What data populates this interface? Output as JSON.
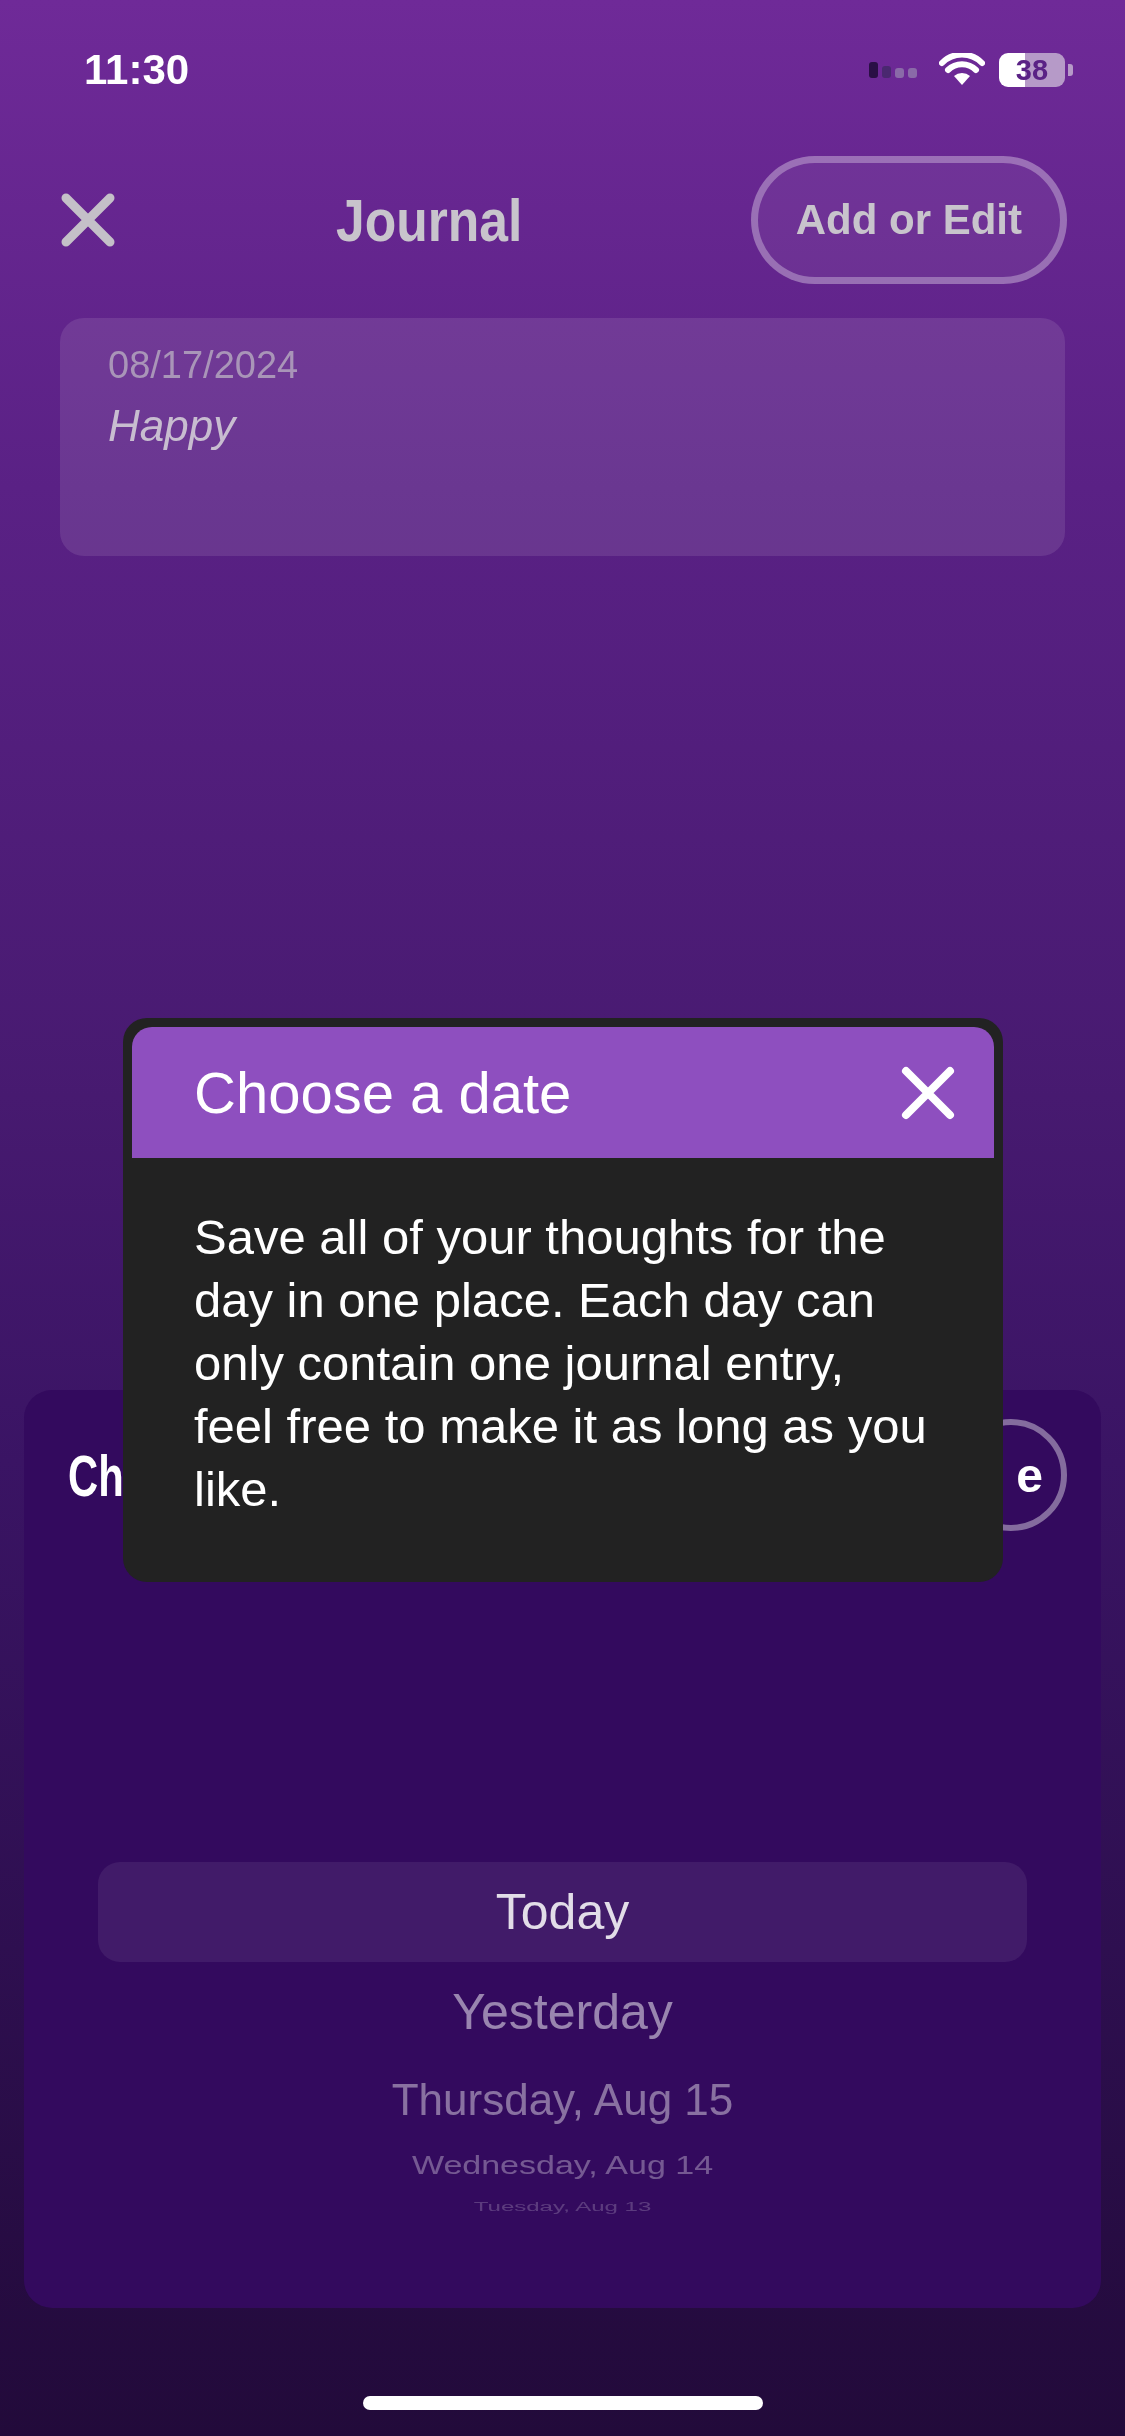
{
  "status_bar": {
    "time": "11:30",
    "battery": "38"
  },
  "header": {
    "title": "Journal",
    "action": "Add or Edit"
  },
  "entries": [
    {
      "date": "08/17/2024",
      "text": "Happy"
    }
  ],
  "sheet": {
    "title": "Ch",
    "button": "e",
    "picker": [
      {
        "label": "Today",
        "selected": true
      },
      {
        "label": "Yesterday",
        "selected": false
      },
      {
        "label": "Thursday, Aug 15",
        "selected": false
      },
      {
        "label": "Wednesday, Aug 14",
        "selected": false
      },
      {
        "label": "Tuesday, Aug 13",
        "selected": false
      }
    ]
  },
  "popup": {
    "title": "Choose a date",
    "body": "Save all of your thoughts for the day in one place. Each day can only contain one journal entry, feel free to make it as long as you like."
  }
}
